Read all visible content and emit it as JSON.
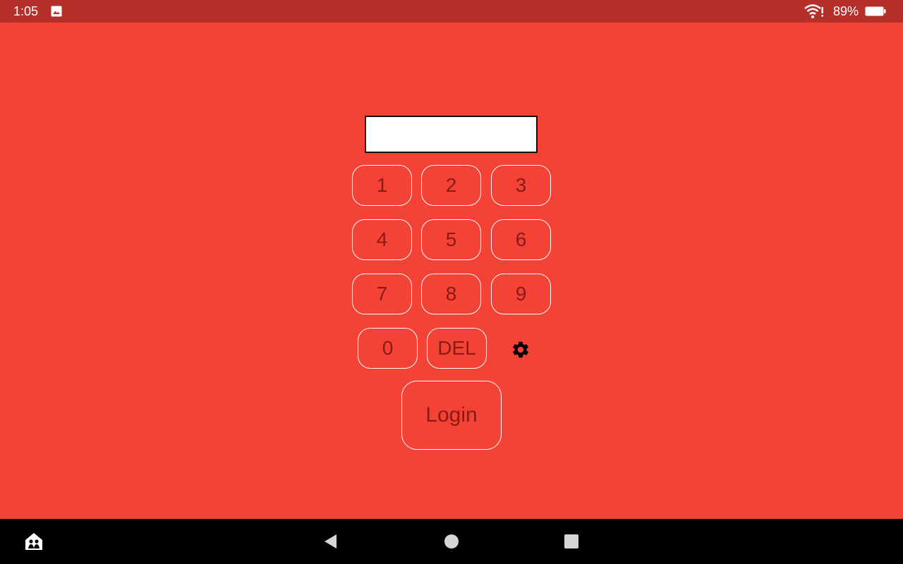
{
  "status_bar": {
    "time": "1:05",
    "battery_percent": "89%",
    "icons": [
      "image-notification-icon",
      "wifi-icon",
      "battery-icon"
    ]
  },
  "pin_entry": {
    "value": ""
  },
  "keypad": {
    "keys": [
      "1",
      "2",
      "3",
      "4",
      "5",
      "6",
      "7",
      "8",
      "9",
      "0"
    ],
    "delete_label": "DEL",
    "settings_icon": "gear-icon"
  },
  "login": {
    "label": "Login"
  },
  "nav_bar": {
    "icons": [
      "home-app-icon",
      "back-icon",
      "home-icon",
      "recents-icon"
    ]
  },
  "colors": {
    "background": "#f44336",
    "status_bar": "#b6302a",
    "key_text": "#8a1a13",
    "key_border": "#ffffff",
    "nav_bar": "#000000"
  }
}
